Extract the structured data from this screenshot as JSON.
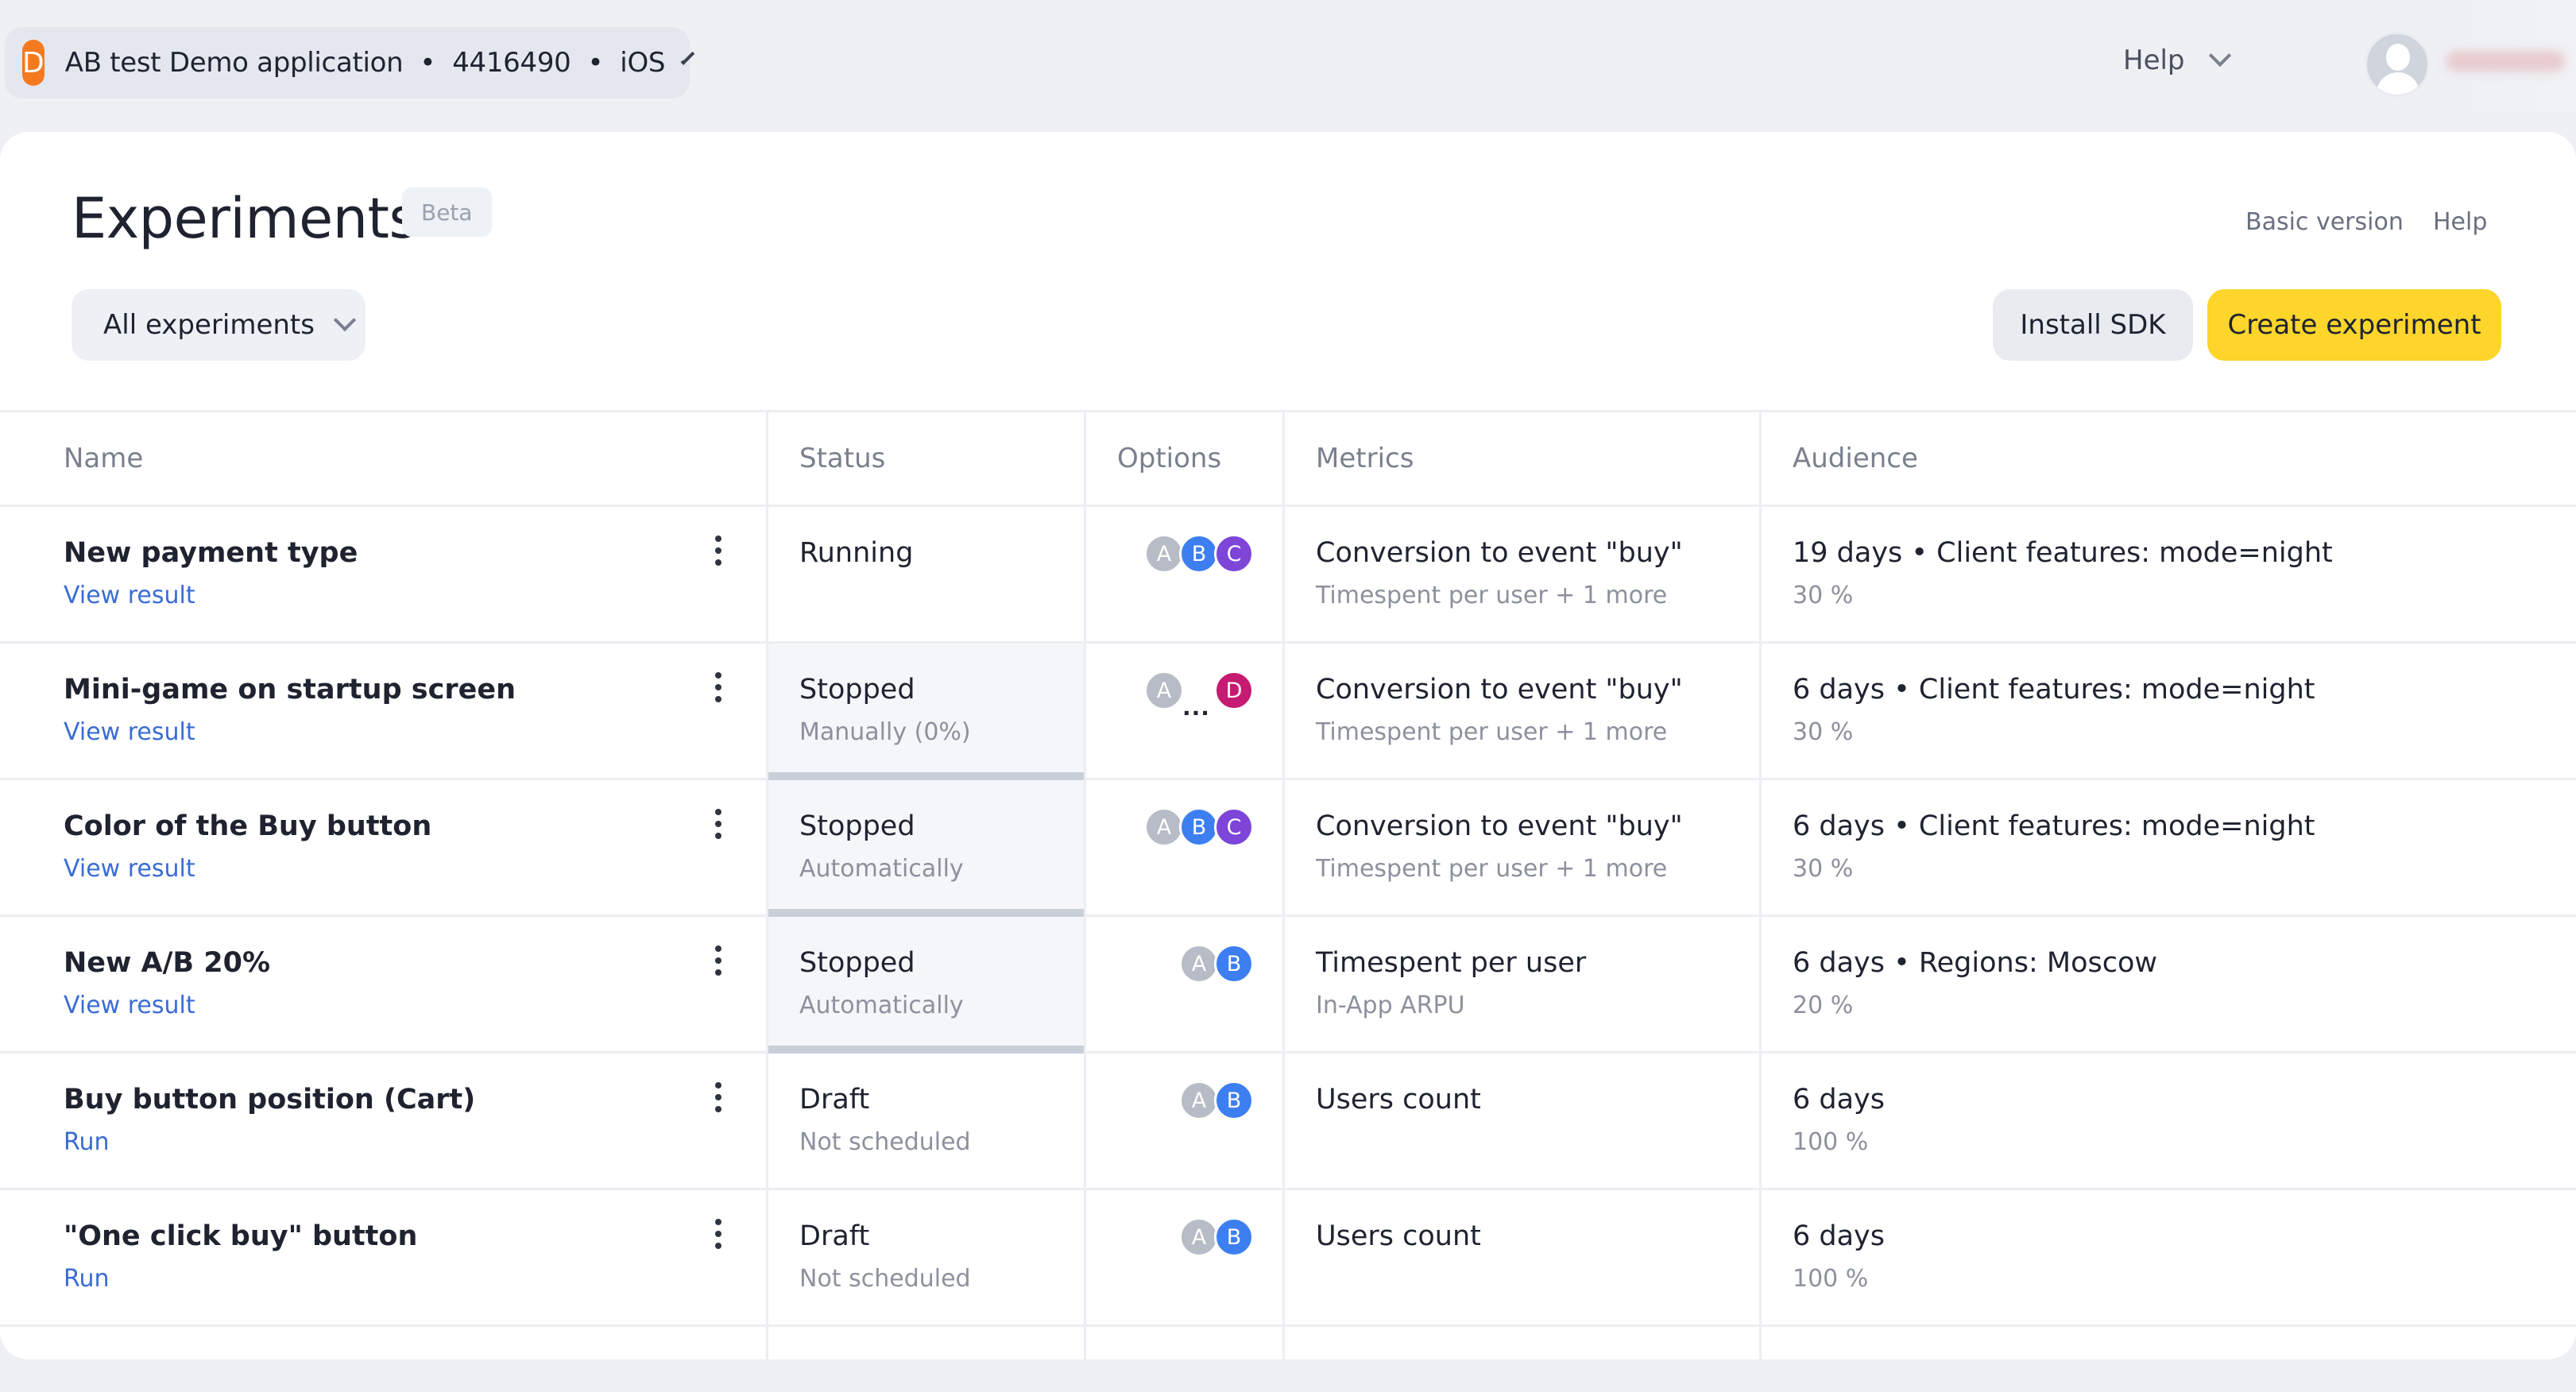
{
  "topbar": {
    "app_badge": "D",
    "app_title": "AB test Demo application  •  4416490  •  iOS",
    "help": "Help"
  },
  "page": {
    "title": "Experiments",
    "beta": "Beta",
    "basic_version": "Basic version",
    "help": "Help",
    "filter": "All experiments",
    "install_sdk": "Install SDK",
    "create_experiment": "Create experiment"
  },
  "table": {
    "headers": {
      "name": "Name",
      "status": "Status",
      "options": "Options",
      "metrics": "Metrics",
      "audience": "Audience"
    },
    "rows": [
      {
        "name": "New payment type",
        "action": "View result",
        "status": "Running",
        "status_sub": "",
        "options": [
          "A",
          "B",
          "C"
        ],
        "metric": "Conversion to event \"buy\"",
        "metric_sub": "Timespent per user + 1 more",
        "audience": "19 days • Client features: mode=night",
        "audience_sub": "30 %"
      },
      {
        "name": "Mini-game on startup screen",
        "action": "View result",
        "status": "Stopped",
        "status_sub": "Manually (0%)",
        "options": [
          "A",
          "...",
          "D"
        ],
        "metric": "Conversion to event \"buy\"",
        "metric_sub": "Timespent per user + 1 more",
        "audience": "6 days • Client features: mode=night",
        "audience_sub": "30 %"
      },
      {
        "name": "Color of the Buy button",
        "action": "View result",
        "status": "Stopped",
        "status_sub": "Automatically",
        "options": [
          "A",
          "B",
          "C"
        ],
        "metric": "Conversion to event \"buy\"",
        "metric_sub": "Timespent per user + 1 more",
        "audience": "6 days • Client features: mode=night",
        "audience_sub": "30 %"
      },
      {
        "name": "New A/B 20%",
        "action": "View result",
        "status": "Stopped",
        "status_sub": "Automatically",
        "options": [
          "A",
          "B"
        ],
        "metric": "Timespent per user",
        "metric_sub": "In-App ARPU",
        "audience": "6 days • Regions: Moscow",
        "audience_sub": "20 %"
      },
      {
        "name": "Buy button position (Cart)",
        "action": "Run",
        "status": "Draft",
        "status_sub": "Not scheduled",
        "options": [
          "A",
          "B"
        ],
        "metric": "Users count",
        "metric_sub": "",
        "audience": "6 days",
        "audience_sub": "100 %"
      },
      {
        "name": "\"One click buy\" button",
        "action": "Run",
        "status": "Draft",
        "status_sub": "Not scheduled",
        "options": [
          "A",
          "B"
        ],
        "metric": "Users count",
        "metric_sub": "",
        "audience": "6 days",
        "audience_sub": "100 %"
      }
    ]
  }
}
